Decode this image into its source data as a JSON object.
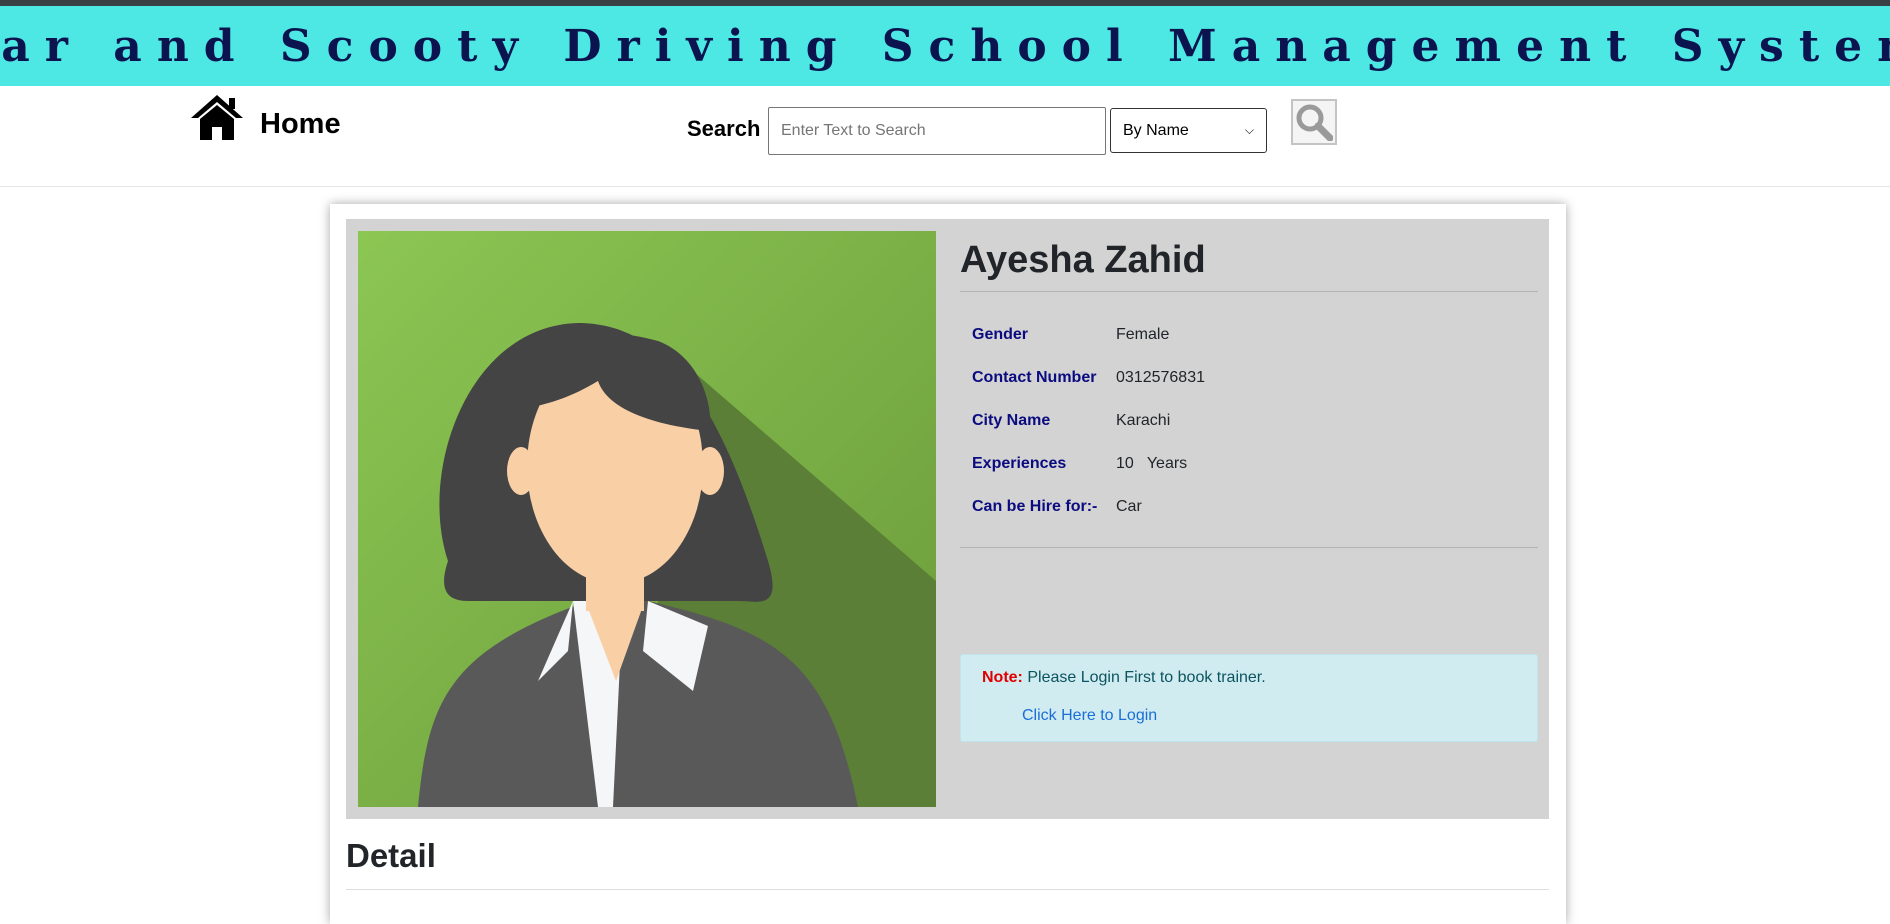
{
  "banner": {
    "title": "Car and Scooty Driving School Management System"
  },
  "nav": {
    "home_label": "Home",
    "search_label": "Search",
    "search_placeholder": "Enter Text to Search",
    "search_by_selected": "By Name"
  },
  "profile": {
    "name": "Ayesha Zahid",
    "details": [
      {
        "label": "Gender",
        "value": "Female"
      },
      {
        "label": "Contact Number",
        "value": "0312576831"
      },
      {
        "label": "City Name",
        "value": "Karachi"
      },
      {
        "label": "Experiences",
        "value": "10   Years"
      },
      {
        "label": "Can be Hire for:-",
        "value": "Car"
      }
    ]
  },
  "note": {
    "label": "Note:",
    "text": "Please Login First to book trainer.",
    "link_text": "Click Here to Login"
  },
  "section": {
    "detail_heading": "Detail"
  },
  "colors": {
    "banner_bg": "#4ee8e4",
    "banner_text": "#0c1450",
    "label_text": "#0b0b80",
    "note_bg": "#d1ecf1",
    "note_label": "#e00000",
    "link": "#1a6fd6"
  },
  "icons": {
    "home": "home-icon",
    "search": "magnifier-icon"
  }
}
